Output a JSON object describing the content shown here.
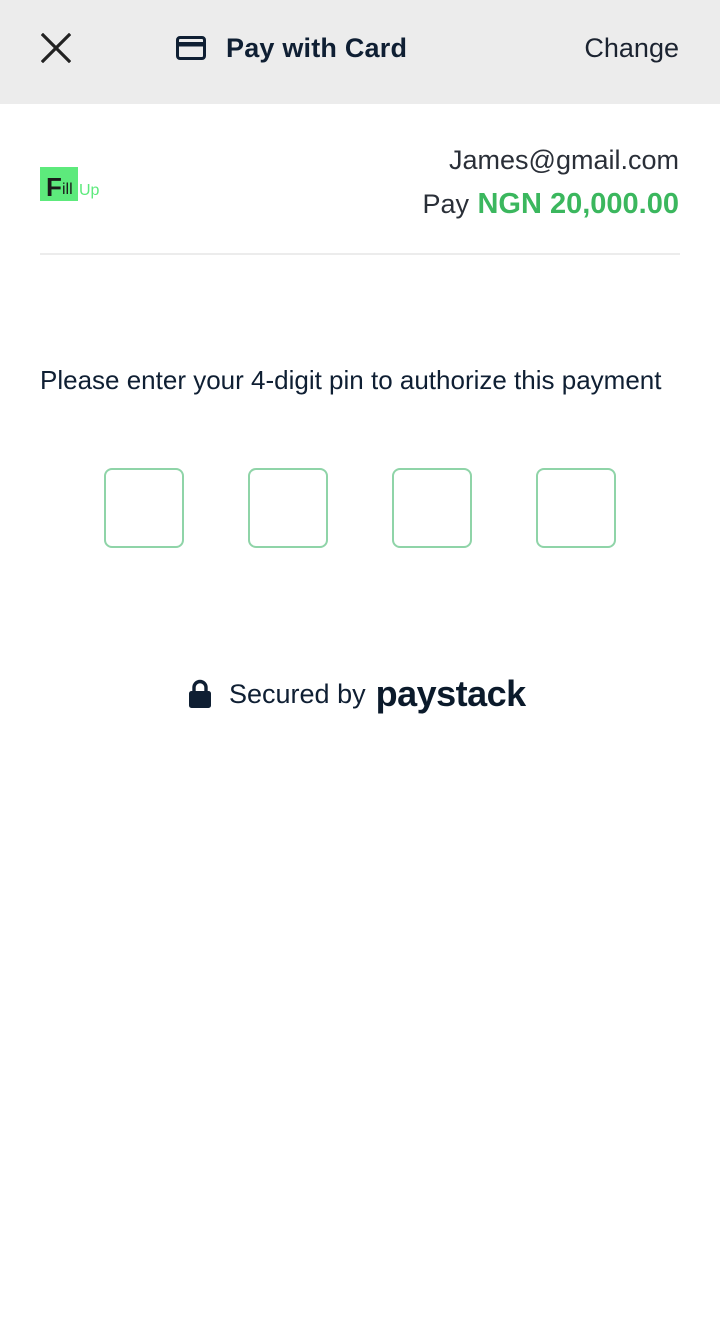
{
  "header": {
    "close_icon": "close-icon",
    "card_icon": "credit-card-icon",
    "title": "Pay with Card",
    "change_label": "Change"
  },
  "merchant": {
    "logo_letter": "F",
    "logo_mid": "ill",
    "logo_end": "Up",
    "logo_color": "#5dea7c"
  },
  "customer": {
    "email": "James@gmail.com",
    "pay_label": "Pay",
    "amount": "NGN 20,000.00",
    "amount_color": "#3bb75e"
  },
  "pin": {
    "instruction": "Please enter your 4-digit pin to authorize this payment",
    "digits": [
      "",
      "",
      "",
      ""
    ],
    "border_color": "#8fd4a8"
  },
  "footer": {
    "lock_icon": "lock-icon",
    "secured_text": "Secured by",
    "brand": "paystack"
  }
}
